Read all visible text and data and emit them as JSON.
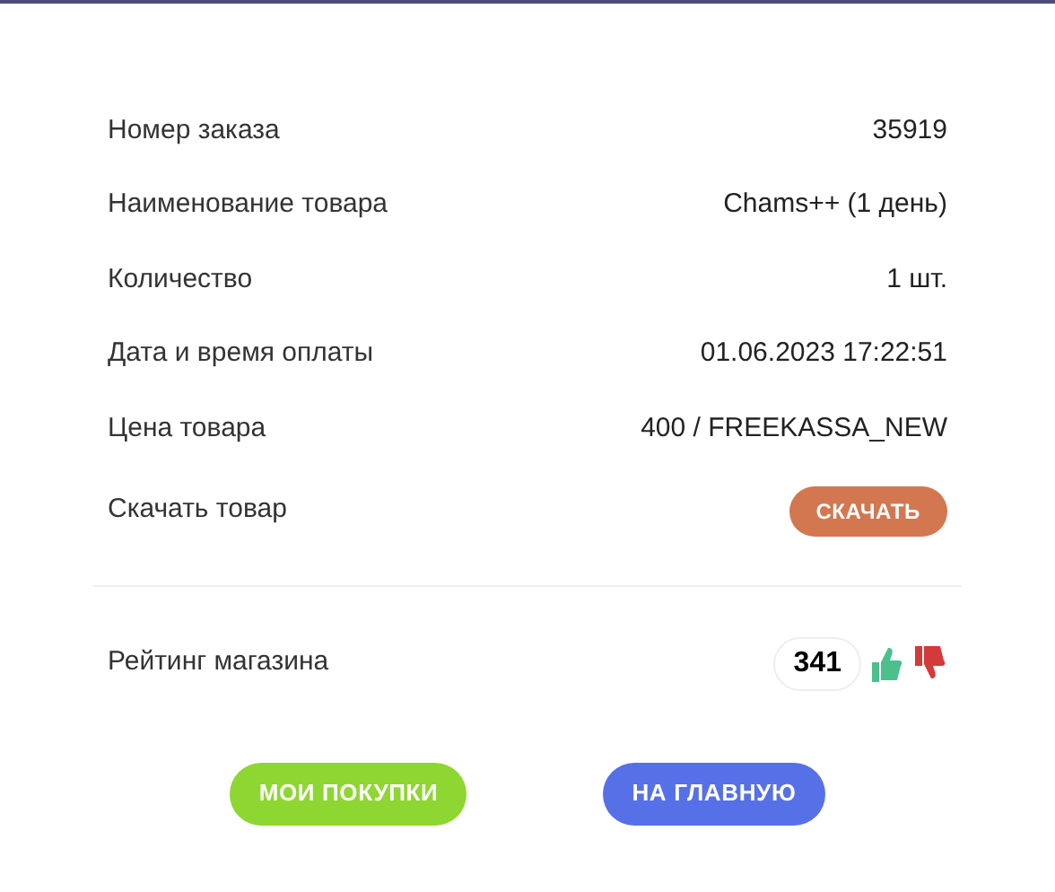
{
  "details": [
    {
      "label": "Номер заказа",
      "value": "35919"
    },
    {
      "label": "Наименование товара",
      "value": "Chams++ (1 день)"
    },
    {
      "label": "Количество",
      "value": "1 шт."
    },
    {
      "label": "Дата и время оплаты",
      "value": "01.06.2023 17:22:51"
    },
    {
      "label": "Цена товара",
      "value": "400 / FREEKASSA_NEW"
    }
  ],
  "download": {
    "label": "Скачать товар",
    "button": "СКАЧАТЬ"
  },
  "rating": {
    "label": "Рейтинг магазина",
    "count": "341"
  },
  "buttons": [
    {
      "label": "МОИ ПОКУПКИ",
      "color": "#8ed631"
    },
    {
      "label": "НА ГЛАВНУЮ",
      "color": "#5670e8"
    }
  ]
}
